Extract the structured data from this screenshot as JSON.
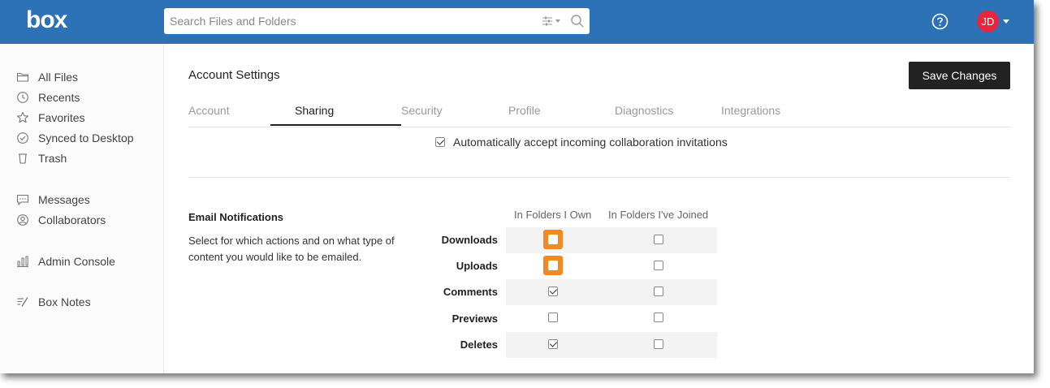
{
  "header": {
    "logo": "box",
    "search_placeholder": "Search Files and Folders",
    "avatar_initials": "JD"
  },
  "sidebar": {
    "items": [
      {
        "label": "All Files",
        "icon": "folder-icon"
      },
      {
        "label": "Recents",
        "icon": "clock-icon"
      },
      {
        "label": "Favorites",
        "icon": "star-icon"
      },
      {
        "label": "Synced to Desktop",
        "icon": "check-circle-icon"
      },
      {
        "label": "Trash",
        "icon": "trash-icon"
      },
      {
        "label": "Messages",
        "icon": "message-icon"
      },
      {
        "label": "Collaborators",
        "icon": "user-circle-icon"
      },
      {
        "label": "Admin Console",
        "icon": "bar-chart-icon"
      },
      {
        "label": "Box Notes",
        "icon": "notes-icon"
      }
    ]
  },
  "main": {
    "title": "Account Settings",
    "save_label": "Save Changes",
    "tabs": [
      {
        "label": "Account",
        "active": false
      },
      {
        "label": "Sharing",
        "active": true
      },
      {
        "label": "Security",
        "active": false
      },
      {
        "label": "Profile",
        "active": false
      },
      {
        "label": "Diagnostics",
        "active": false
      },
      {
        "label": "Integrations",
        "active": false
      }
    ],
    "auto_accept": {
      "label": "Automatically accept incoming collaboration invitations",
      "checked": true
    },
    "email": {
      "title": "Email Notifications",
      "description": "Select for which actions and on what type of content you would like to be emailed.",
      "columns": [
        "In Folders I Own",
        "In Folders I've Joined"
      ],
      "rows": [
        {
          "label": "Downloads",
          "own": false,
          "joined": false
        },
        {
          "label": "Uploads",
          "own": false,
          "joined": false
        },
        {
          "label": "Comments",
          "own": true,
          "joined": false
        },
        {
          "label": "Previews",
          "own": false,
          "joined": false
        },
        {
          "label": "Deletes",
          "own": true,
          "joined": false
        }
      ]
    }
  },
  "colors": {
    "header_bg": "#2d72b6",
    "avatar_bg": "#e8253f",
    "highlight": "#f28a1f",
    "button_bg": "#222222"
  }
}
